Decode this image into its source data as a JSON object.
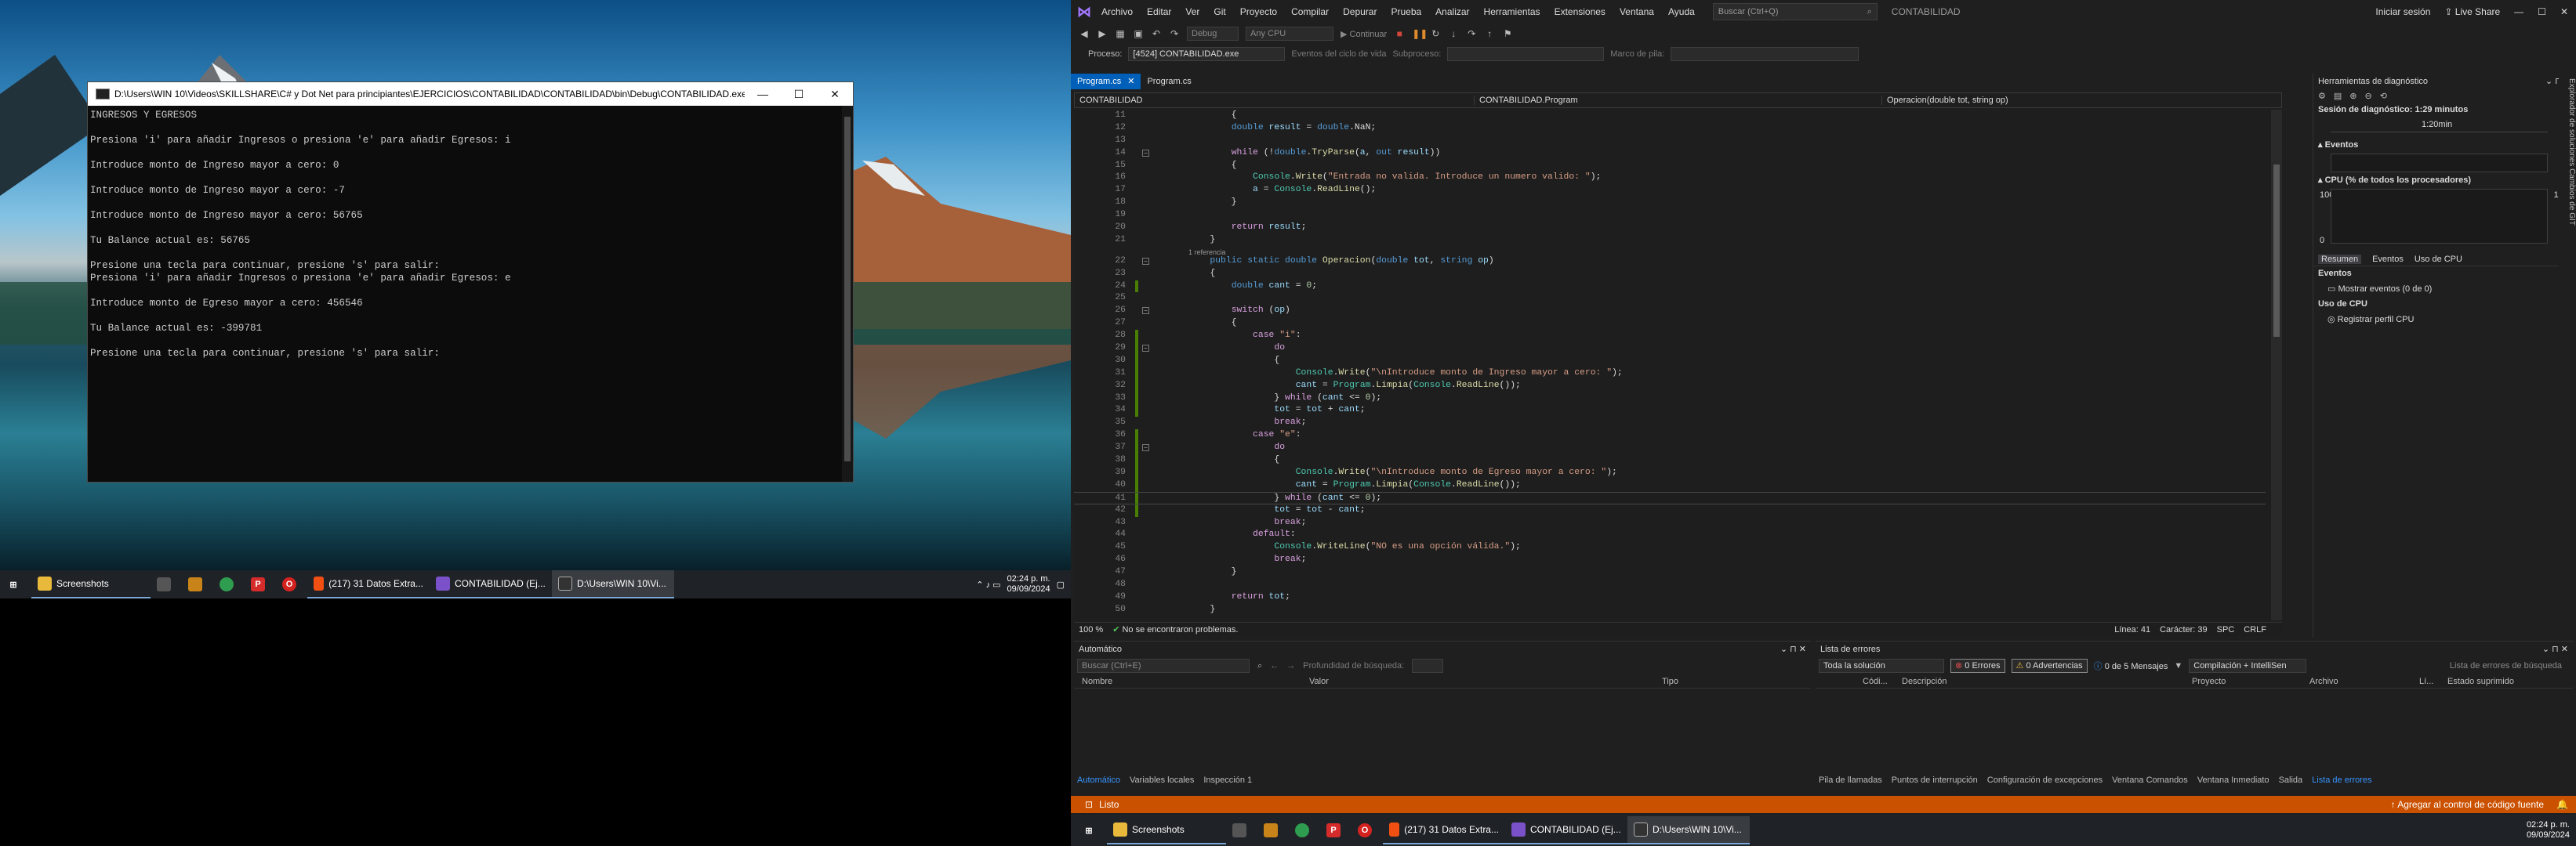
{
  "left_taskbar": {
    "items": [
      {
        "icon": "windows-start-icon",
        "label": ""
      },
      {
        "icon": "folder-icon",
        "label": "Screenshots"
      },
      {
        "icon": "app-icon",
        "label": ""
      },
      {
        "icon": "app-icon",
        "label": ""
      },
      {
        "icon": "chrome-icon",
        "label": ""
      },
      {
        "icon": "app-icon",
        "label": ""
      },
      {
        "icon": "opera-icon",
        "label": ""
      },
      {
        "icon": "brave-icon",
        "label": "(217) 31 Datos Extra..."
      },
      {
        "icon": "visual-studio-icon",
        "label": "CONTABILIDAD (Ej..."
      },
      {
        "icon": "console-icon",
        "label": "D:\\Users\\WIN 10\\Vi..."
      }
    ],
    "time": "02:24 p. m.",
    "date": "09/09/2024"
  },
  "console": {
    "title": "D:\\Users\\WIN 10\\Videos\\SKILLSHARE\\C# y Dot Net para principiantes\\EJERCICIOS\\CONTABILIDAD\\CONTABILIDAD\\bin\\Debug\\CONTABILIDAD.exe",
    "lines": [
      "INGRESOS Y EGRESOS",
      "",
      "Presiona 'i' para añadir Ingresos o presiona 'e' para añadir Egresos: i",
      "",
      "Introduce monto de Ingreso mayor a cero: 0",
      "",
      "Introduce monto de Ingreso mayor a cero: -7",
      "",
      "Introduce monto de Ingreso mayor a cero: 56765",
      "",
      "Tu Balance actual es: 56765",
      "",
      "Presione una tecla para continuar, presione 's' para salir:",
      "Presiona 'i' para añadir Ingresos o presiona 'e' para añadir Egresos: e",
      "",
      "Introduce monto de Egreso mayor a cero: 456546",
      "",
      "Tu Balance actual es: -399781",
      "",
      "Presione una tecla para continuar, presione 's' para salir:"
    ]
  },
  "vs": {
    "menu": [
      "Archivo",
      "Editar",
      "Ver",
      "Git",
      "Proyecto",
      "Compilar",
      "Depurar",
      "Prueba",
      "Analizar",
      "Herramientas",
      "Extensiones",
      "Ventana",
      "Ayuda"
    ],
    "search_placeholder": "Buscar (Ctrl+Q)",
    "project": "CONTABILIDAD",
    "signin": "Iniciar sesión",
    "liveshare": "Live Share",
    "toolbar1": {
      "config": "Debug",
      "platform": "Any CPU",
      "continue": "Continuar"
    },
    "toolbar2": {
      "process_label": "Proceso:",
      "process": "[4524] CONTABILIDAD.exe",
      "lifecycle": "Eventos del ciclo de vida",
      "thread": "Subproceso:",
      "stack": "Marco de pila:"
    },
    "tabs": [
      "Program.cs",
      "Program.cs"
    ],
    "nav": {
      "project": "CONTABILIDAD",
      "class": "CONTABILIDAD.Program",
      "method": "Operacion(double tot, string op)"
    },
    "status": {
      "zoom": "100 %",
      "issues": "No se encontraron problemas.",
      "line": "Línea: 41",
      "col": "Carácter: 39",
      "spc": "SPC",
      "crlf": "CRLF"
    },
    "diag": {
      "title": "Herramientas de diagnóstico",
      "session": "Sesión de diagnóstico: 1:29 minutos",
      "time": "1:20min",
      "events": "Eventos",
      "cpu": "CPU (% de todos los procesadores)",
      "cpu_max": "100",
      "cpu_min": "0",
      "tabs": [
        "Resumen",
        "Eventos",
        "Uso de CPU"
      ],
      "ev_section": "Eventos",
      "show_events": "Mostrar eventos (0 de 0)",
      "cpu_section": "Uso de CPU",
      "register": "Registrar perfil CPU",
      "side": "Explorador de soluciones   Cambios de GIT"
    },
    "auto": {
      "title": "Automático",
      "search": "Buscar (Ctrl+E)",
      "depth": "Profundidad de búsqueda:",
      "cols": [
        "Nombre",
        "Valor",
        "Tipo"
      ],
      "tabs": [
        "Automático",
        "Variables locales",
        "Inspección 1"
      ]
    },
    "errors": {
      "title": "Lista de errores",
      "scope": "Toda la solución",
      "errors": "0 Errores",
      "warnings": "0 Advertencias",
      "messages": "0 de 5 Mensajes",
      "build": "Compilación + IntelliSen",
      "search": "Lista de errores de búsqueda",
      "cols": [
        "Códi...",
        "Descripción",
        "Proyecto",
        "Archivo",
        "Lí...",
        "Estado suprimido"
      ],
      "tabs": [
        "Pila de llamadas",
        "Puntos de interrupción",
        "Configuración de excepciones",
        "Ventana Comandos",
        "Ventana Inmediato",
        "Salida",
        "Lista de errores"
      ]
    },
    "statusbar": {
      "left": "Listo",
      "right": "Agregar al control de código fuente"
    }
  },
  "right_taskbar": {
    "items": [
      {
        "icon": "windows-start-icon",
        "label": ""
      },
      {
        "icon": "folder-icon",
        "label": "Screenshots"
      },
      {
        "icon": "app-icon",
        "label": ""
      },
      {
        "icon": "app-icon",
        "label": ""
      },
      {
        "icon": "chrome-icon",
        "label": ""
      },
      {
        "icon": "app-icon",
        "label": ""
      },
      {
        "icon": "opera-icon",
        "label": ""
      },
      {
        "icon": "brave-icon",
        "label": "(217) 31 Datos Extra..."
      },
      {
        "icon": "visual-studio-icon",
        "label": "CONTABILIDAD (Ej..."
      },
      {
        "icon": "console-icon",
        "label": "D:\\Users\\WIN 10\\Vi..."
      }
    ],
    "time": "02:24 p. m.",
    "date": "09/09/2024"
  }
}
